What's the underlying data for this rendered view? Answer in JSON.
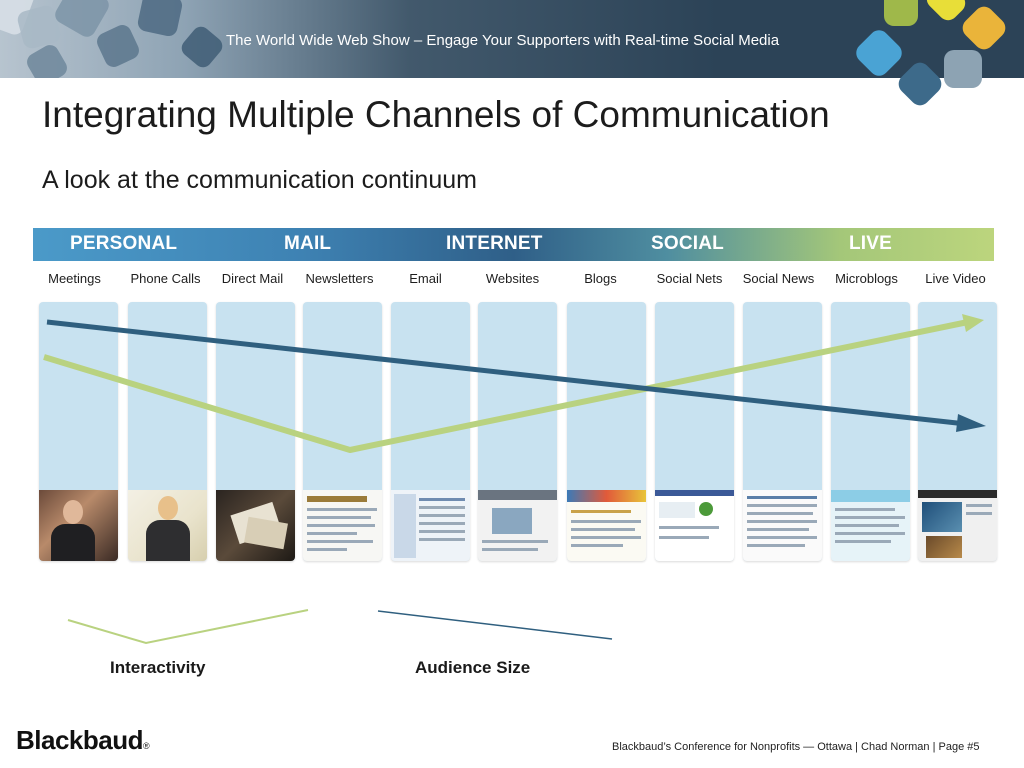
{
  "header": {
    "show_title": "The World Wide Web Show – Engage Your Supporters with Real-time Social Media"
  },
  "slide": {
    "title": "Integrating Multiple Channels of Communication",
    "subtitle": "A look at the communication continuum"
  },
  "band": {
    "categories": [
      "PERSONAL",
      "MAIL",
      "INTERNET",
      "SOCIAL",
      "LIVE"
    ]
  },
  "channels": [
    "Meetings",
    "Phone Calls",
    "Direct Mail",
    "Newsletters",
    "Email",
    "Websites",
    "Blogs",
    "Social Nets",
    "Social News",
    "Microblogs",
    "Live Video"
  ],
  "legend": {
    "interactivity": "Interactivity",
    "audience_size": "Audience Size"
  },
  "footer": {
    "logo": "Blackbaud",
    "logo_mark": "®",
    "text": "Blackbaud’s Conference for Nonprofits — Ottawa  |  Chad Norman  |  Page #5"
  },
  "colors": {
    "interactivity_line": "#b9d280",
    "audience_line": "#2f5f7f",
    "column_fill": "#c8e2f0"
  }
}
